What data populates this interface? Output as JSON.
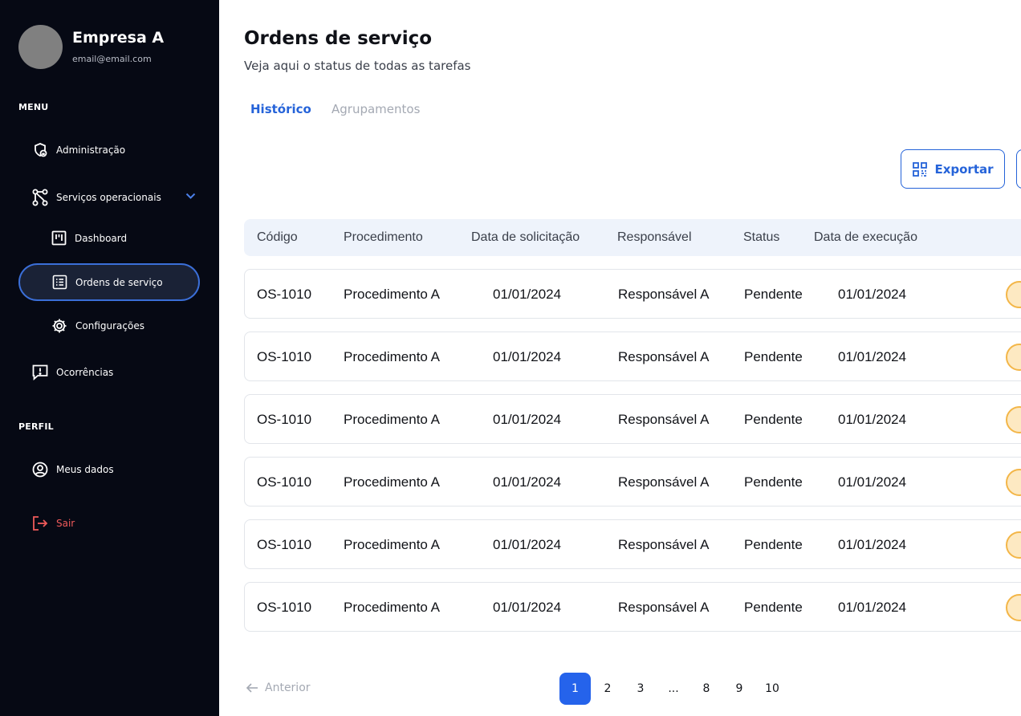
{
  "sidebar": {
    "company": "Empresa A",
    "email": "email@email.com",
    "menu_label": "MENU",
    "items": {
      "admin": "Administração",
      "servicos": "Serviços operacionais",
      "dashboard": "Dashboard",
      "ordens": "Ordens de serviço",
      "config": "Configurações",
      "ocorrencias": "Ocorrências"
    },
    "perfil_label": "PERFIL",
    "meus_dados": "Meus dados",
    "sair": "Sair"
  },
  "page": {
    "title": "Ordens de serviço",
    "subtitle": "Veja aqui o status de todas as tarefas"
  },
  "tabs": [
    "Histórico",
    "Agrupamentos"
  ],
  "toolbar": {
    "export_label": "Exportar"
  },
  "table": {
    "headers": [
      "Código",
      "Procedimento",
      "Data de solicitação",
      "Responsável",
      "Status",
      "Data de execução"
    ],
    "rows": [
      [
        "OS-1010",
        "Procedimento A",
        "01/01/2024",
        "Responsável A",
        "Pendente",
        "01/01/2024"
      ],
      [
        "OS-1010",
        "Procedimento A",
        "01/01/2024",
        "Responsável A",
        "Pendente",
        "01/01/2024"
      ],
      [
        "OS-1010",
        "Procedimento A",
        "01/01/2024",
        "Responsável A",
        "Pendente",
        "01/01/2024"
      ],
      [
        "OS-1010",
        "Procedimento A",
        "01/01/2024",
        "Responsável A",
        "Pendente",
        "01/01/2024"
      ],
      [
        "OS-1010",
        "Procedimento A",
        "01/01/2024",
        "Responsável A",
        "Pendente",
        "01/01/2024"
      ],
      [
        "OS-1010",
        "Procedimento A",
        "01/01/2024",
        "Responsável A",
        "Pendente",
        "01/01/2024"
      ]
    ]
  },
  "pagination": {
    "prev_label": "Anterior",
    "pages": [
      "1",
      "2",
      "3",
      "...",
      "8",
      "9",
      "10"
    ]
  },
  "colors": {
    "sidebar_bg": "#060914",
    "accent": "#2563d9",
    "danger": "#ef5a5a",
    "pending": "#f3b648"
  },
  "icons": {
    "admin": "shield-lock-icon",
    "servicos": "workflow-icon",
    "dashboard": "kanban-icon",
    "ordens": "list-icon",
    "config": "gear-icon",
    "ocorrencias": "alert-message-icon",
    "meus_dados": "user-circle-icon",
    "sair": "logout-icon",
    "export": "qr-code-icon",
    "row_status": "pending-clock-icon"
  }
}
